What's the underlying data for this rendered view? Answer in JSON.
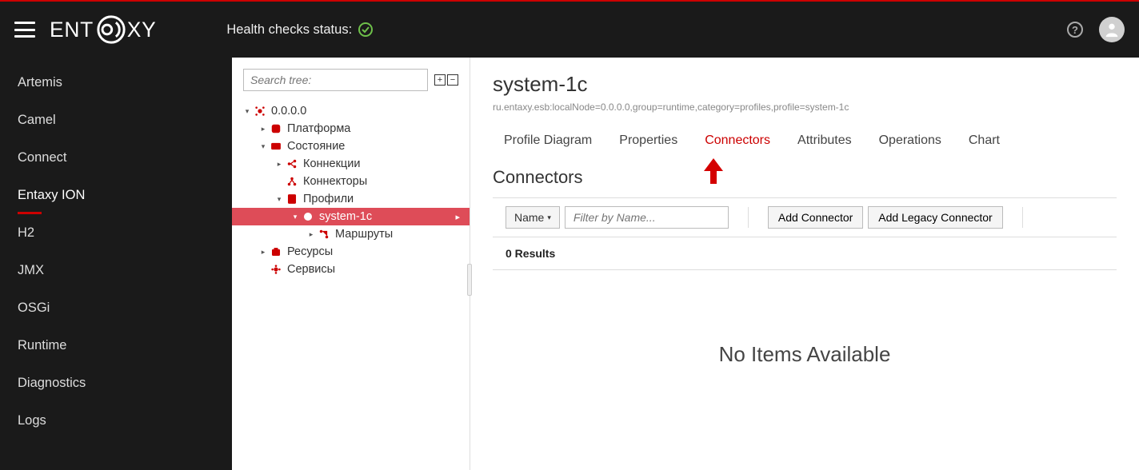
{
  "header": {
    "health_label": "Health checks status:",
    "health_state": "ok"
  },
  "sidebar": {
    "items": [
      {
        "label": "Artemis",
        "active": false
      },
      {
        "label": "Camel",
        "active": false
      },
      {
        "label": "Connect",
        "active": false
      },
      {
        "label": "Entaxy ION",
        "active": true
      },
      {
        "label": "H2",
        "active": false
      },
      {
        "label": "JMX",
        "active": false
      },
      {
        "label": "OSGi",
        "active": false
      },
      {
        "label": "Runtime",
        "active": false
      },
      {
        "label": "Diagnostics",
        "active": false
      },
      {
        "label": "Logs",
        "active": false
      }
    ]
  },
  "tree": {
    "search_placeholder": "Search tree:",
    "root": "0.0.0.0",
    "platform": "Платформа",
    "state": "Состояние",
    "connections": "Коннекции",
    "connectors": "Коннекторы",
    "profiles": "Профили",
    "system1c": "system-1c",
    "routes": "Маршруты",
    "resources": "Ресурсы",
    "services": "Сервисы"
  },
  "main": {
    "title": "system-1c",
    "subtitle": "ru.entaxy.esb:localNode=0.0.0.0,group=runtime,category=profiles,profile=system-1c",
    "tabs": [
      {
        "label": "Profile Diagram",
        "active": false
      },
      {
        "label": "Properties",
        "active": false
      },
      {
        "label": "Connectors",
        "active": true
      },
      {
        "label": "Attributes",
        "active": false
      },
      {
        "label": "Operations",
        "active": false
      },
      {
        "label": "Chart",
        "active": false
      }
    ],
    "section_title": "Connectors",
    "filter_label": "Name",
    "filter_placeholder": "Filter by Name...",
    "add_connector": "Add Connector",
    "add_legacy": "Add Legacy Connector",
    "results_label": "0 Results",
    "empty_text": "No Items Available"
  }
}
